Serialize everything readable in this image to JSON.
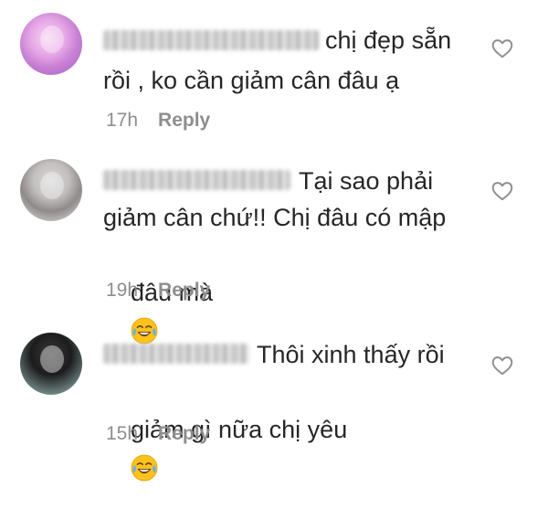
{
  "comments": [
    {
      "line1": "chị đẹp sẵn",
      "line2": "rồi , ko cần giảm cân đâu ạ",
      "time": "17h",
      "reply_label": "Reply"
    },
    {
      "line1": "Tại sao phải",
      "line2": "giảm cân chứ!! Chị đâu có mập",
      "line3": "đâu mà",
      "emoji": "tears-of-joy-emoji",
      "time": "19h",
      "reply_label": "Reply"
    },
    {
      "line1": "Thôi xinh thấy rồi",
      "line2": "giảm gì nữa chị yêu",
      "emoji": "tears-of-joy-emoji",
      "time": "15h",
      "reply_label": "Reply"
    }
  ],
  "icons": {
    "like": "heart-outline-icon"
  },
  "colors": {
    "text": "#262626",
    "meta": "#8e8e8e",
    "background": "#ffffff"
  }
}
